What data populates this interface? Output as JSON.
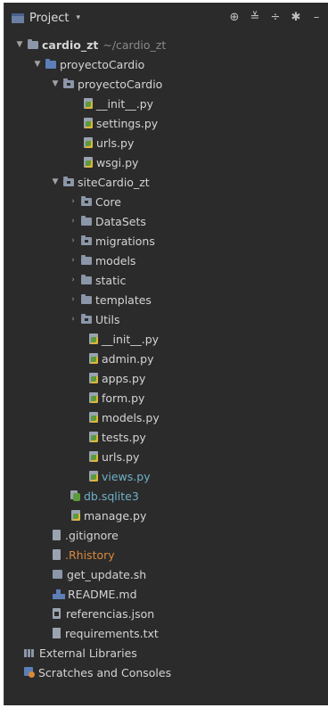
{
  "toolbar": {
    "title": "Project",
    "caret": "▾",
    "icons": {
      "locate": "⊕",
      "collapse": "≚",
      "expand": "÷",
      "settings": "✱",
      "hide": "–"
    }
  },
  "tree": {
    "root": {
      "label": "cardio_zt",
      "path": "~/cardio_zt"
    },
    "proyectoCardio_outer": "proyectoCardio",
    "proyectoCardio_inner": "proyectoCardio",
    "inner_files": [
      "__init__.py",
      "settings.py",
      "urls.py",
      "wsgi.py"
    ],
    "siteCardio": "siteCardio_zt",
    "site_folders": [
      "Core",
      "DataSets",
      "migrations",
      "models",
      "static",
      "templates",
      "Utils"
    ],
    "site_files": [
      "__init__.py",
      "admin.py",
      "apps.py",
      "form.py",
      "models.py",
      "tests.py",
      "urls.py",
      "views.py"
    ],
    "db": "db.sqlite3",
    "manage": "manage.py",
    "gitignore": ".gitignore",
    "rhistory": ".Rhistory",
    "get_update": "get_update.sh",
    "readme": "README.md",
    "referencias": "referencias.json",
    "requirements": "requirements.txt",
    "external": "External Libraries",
    "scratches": "Scratches and Consoles"
  },
  "colors": {
    "background": "#2b2b2b",
    "text": "#d4d4d4",
    "path": "#8a8a8a",
    "new_file": "#5cac6e",
    "ignored": "#d9893d",
    "modified": "#6fb0c8"
  }
}
